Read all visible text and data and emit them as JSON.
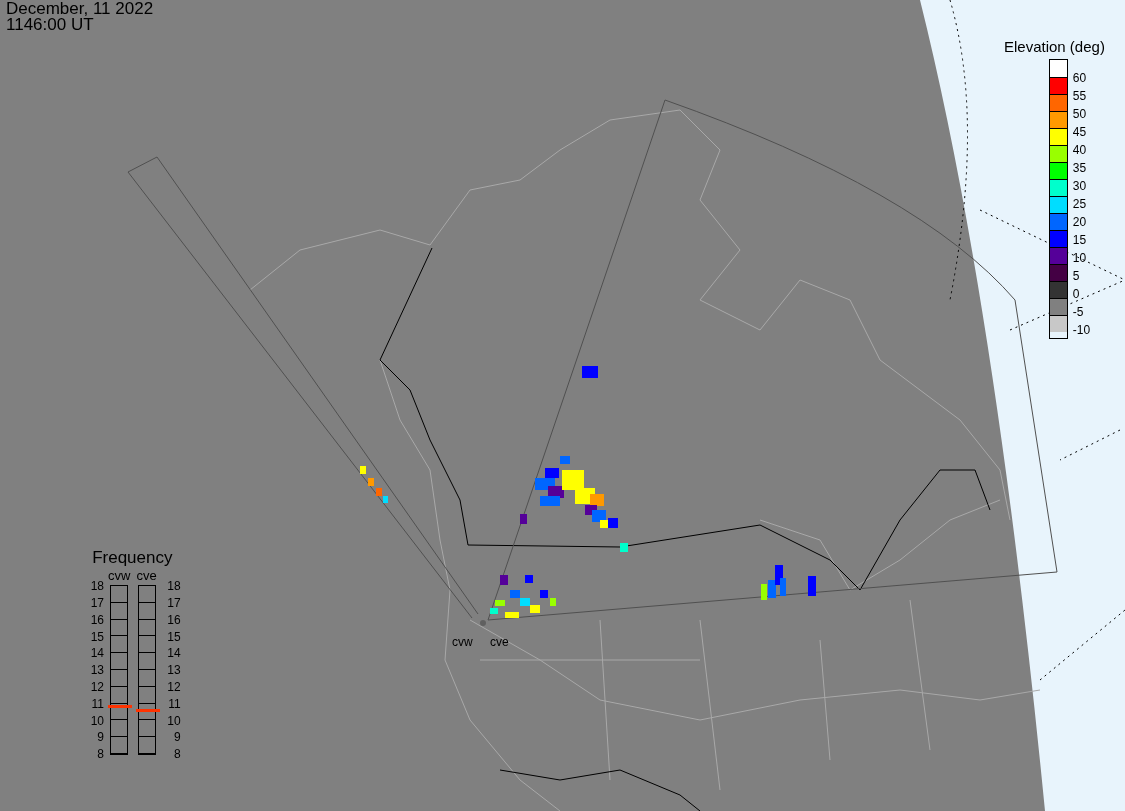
{
  "timestamp": {
    "date": "December, 11 2022",
    "time": "1146:00 UT"
  },
  "elevation_legend": {
    "title": "Elevation (deg)",
    "swatches": [
      {
        "color": "#ffffff"
      },
      {
        "color": "#ff0000"
      },
      {
        "color": "#ff6600"
      },
      {
        "color": "#ff9900"
      },
      {
        "color": "#ffff00"
      },
      {
        "color": "#99ff00"
      },
      {
        "color": "#00ff00"
      },
      {
        "color": "#00ffcc"
      },
      {
        "color": "#00ddff"
      },
      {
        "color": "#0066ff"
      },
      {
        "color": "#0000ff"
      },
      {
        "color": "#550099"
      },
      {
        "color": "#440044"
      },
      {
        "color": "#333333"
      },
      {
        "color": "#808080"
      },
      {
        "color": "#c8c8c8"
      }
    ],
    "labels": [
      "60",
      "55",
      "50",
      "45",
      "40",
      "35",
      "30",
      "25",
      "20",
      "15",
      "10",
      "5",
      "0",
      "-5",
      "-10"
    ]
  },
  "frequency": {
    "title": "Frequency",
    "radars": [
      {
        "name": "cvw",
        "level": 0.28,
        "ticks": [
          "18",
          "17",
          "16",
          "15",
          "14",
          "13",
          "12",
          "11",
          "10",
          "9",
          "8"
        ]
      },
      {
        "name": "cve",
        "level": 0.26,
        "ticks": [
          "18",
          "17",
          "16",
          "15",
          "14",
          "13",
          "12",
          "11",
          "10",
          "9",
          "8"
        ]
      }
    ]
  },
  "map": {
    "radar_labels": [
      "cvw",
      "cve"
    ]
  }
}
